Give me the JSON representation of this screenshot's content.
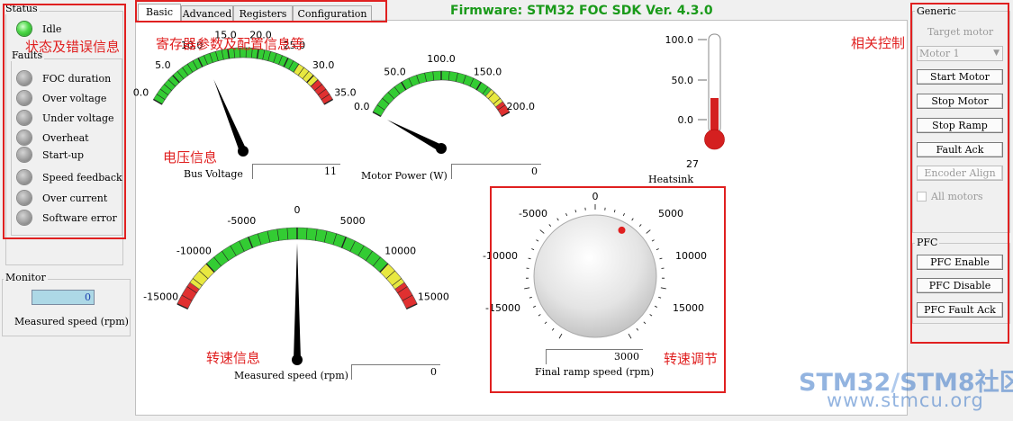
{
  "status": {
    "title": "Status",
    "state": "Idle",
    "faults_title": "Faults",
    "faults": [
      "FOC duration",
      "Over voltage",
      "Under voltage",
      "Overheat",
      "Start-up",
      "Speed feedback",
      "Over current",
      "Software error"
    ]
  },
  "monitor": {
    "title": "Monitor",
    "speed_value": "0",
    "speed_label": "Measured speed (rpm)"
  },
  "tabs": [
    "Basic",
    "Advanced",
    "Registers",
    "Configuration"
  ],
  "firmware": "Firmware: STM32 FOC SDK Ver. 4.3.0",
  "bus_voltage": {
    "ticks": [
      "0.0",
      "5.0",
      "10.0",
      "15.0",
      "20.0",
      "25.0",
      "30.0",
      "35.0"
    ],
    "label": "Bus Voltage",
    "value": "11",
    "reading": 11,
    "range": [
      0,
      35
    ]
  },
  "motor_power": {
    "ticks": [
      "0.0",
      "50.0",
      "100.0",
      "150.0",
      "200.0"
    ],
    "label": "Motor Power (W)",
    "value": "0",
    "reading": 0,
    "range": [
      0,
      200
    ]
  },
  "heatsink": {
    "ticks": [
      "100.0",
      "50.0",
      "0.0"
    ],
    "value": "27",
    "label": "Heatsink",
    "reading": 27,
    "range": [
      0,
      100
    ]
  },
  "measured_speed": {
    "ticks": [
      "-15000",
      "-10000",
      "-5000",
      "0",
      "5000",
      "10000",
      "15000"
    ],
    "label": "Measured speed (rpm)",
    "value": "0",
    "reading": 0,
    "range": [
      -15000,
      15000
    ]
  },
  "ramp": {
    "ticks": [
      "0",
      "5000",
      "10000",
      "15000",
      "-5000",
      "-10000",
      "-15000"
    ],
    "value": "3000",
    "label": "Final ramp speed (rpm)",
    "setpoint": 3000
  },
  "generic": {
    "title": "Generic",
    "target_motor_label": "Target motor",
    "motor_select": "Motor 1",
    "buttons": [
      "Start Motor",
      "Stop Motor",
      "Stop Ramp",
      "Fault Ack",
      "Encoder Align"
    ],
    "all_motors": "All motors"
  },
  "pfc": {
    "title": "PFC",
    "buttons": [
      "PFC Enable",
      "PFC Disable",
      "PFC Fault Ack"
    ]
  },
  "annotations": {
    "status_info": "状态及错误信息",
    "register_info": "寄存器参数及配置信息等",
    "control": "相关控制",
    "voltage": "电压信息",
    "speed": "转速信息",
    "speed_adjust": "转速调节"
  },
  "watermark": {
    "line1a": "STM32",
    "line1b": "/",
    "line1c": "STM8社区",
    "line2": "www.stmcu.org"
  },
  "colors": {
    "accent_red": "#e02020",
    "firmware_green": "#1a9a1a",
    "gauge_green": "#33cc33",
    "gauge_yellow": "#e8e840",
    "gauge_red": "#e03030",
    "thermo_red": "#d42020",
    "watermark_blue": "#3c78c8"
  }
}
